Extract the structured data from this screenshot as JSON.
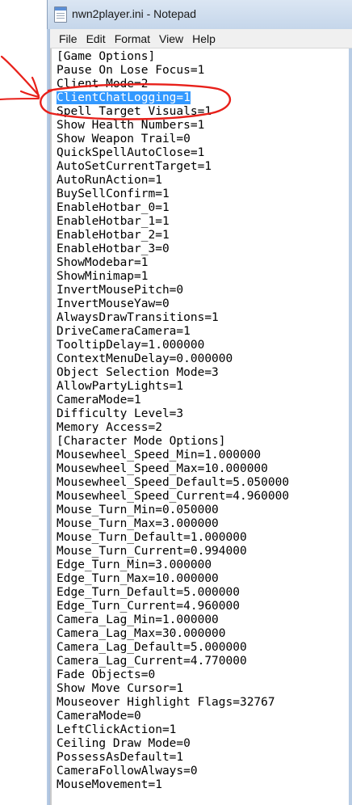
{
  "window": {
    "title": "nwn2player.ini - Notepad",
    "icon": "notepad-icon"
  },
  "menu": [
    "File",
    "Edit",
    "Format",
    "View",
    "Help"
  ],
  "editor": {
    "selected_line_index": 3,
    "lines": [
      "[Game Options]",
      "Pause On Lose Focus=1",
      "Client Mode=2",
      "ClientChatLogging=1",
      "Spell Target Visuals=1",
      "Show Health Numbers=1",
      "Show Weapon Trail=0",
      "QuickSpellAutoClose=1",
      "AutoSetCurrentTarget=1",
      "AutoRunAction=1",
      "BuySellConfirm=1",
      "EnableHotbar_0=1",
      "EnableHotbar_1=1",
      "EnableHotbar_2=1",
      "EnableHotbar_3=0",
      "ShowModebar=1",
      "ShowMinimap=1",
      "InvertMousePitch=0",
      "InvertMouseYaw=0",
      "AlwaysDrawTransitions=1",
      "DriveCameraCamera=1",
      "TooltipDelay=1.000000",
      "ContextMenuDelay=0.000000",
      "Object Selection Mode=3",
      "AllowPartyLights=1",
      "CameraMode=1",
      "Difficulty Level=3",
      "Memory Access=2",
      "[Character Mode Options]",
      "Mousewheel_Speed_Min=1.000000",
      "Mousewheel_Speed_Max=10.000000",
      "Mousewheel_Speed_Default=5.050000",
      "Mousewheel_Speed_Current=4.960000",
      "Mouse_Turn_Min=0.050000",
      "Mouse_Turn_Max=3.000000",
      "Mouse_Turn_Default=1.000000",
      "Mouse_Turn_Current=0.994000",
      "Edge_Turn_Min=3.000000",
      "Edge_Turn_Max=10.000000",
      "Edge_Turn_Default=5.000000",
      "Edge_Turn_Current=4.960000",
      "Camera_Lag_Min=1.000000",
      "Camera_Lag_Max=30.000000",
      "Camera_Lag_Default=5.000000",
      "Camera_Lag_Current=4.770000",
      "Fade Objects=0",
      "Show Move Cursor=1",
      "Mouseover Highlight Flags=32767",
      "CameraMode=0",
      "LeftClickAction=1",
      "Ceiling Draw Mode=0",
      "PossessAsDefault=1",
      "CameraFollowAlways=0",
      "MouseMovement=1"
    ]
  },
  "colors": {
    "selection": "#3399ff",
    "annotation": "#e8201a"
  }
}
